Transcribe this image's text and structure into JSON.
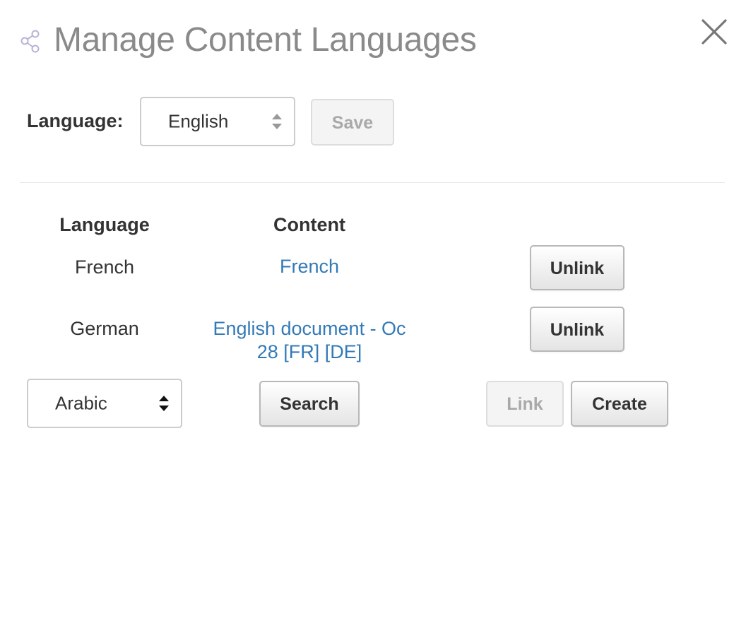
{
  "dialog": {
    "title": "Manage Content Languages",
    "icon": "share-icon"
  },
  "top_form": {
    "label": "Language:",
    "select_value": "English",
    "save_label": "Save"
  },
  "table": {
    "headers": {
      "language": "Language",
      "content": "Content"
    },
    "rows": [
      {
        "language": "French",
        "content_line1": "French",
        "content_line2": "",
        "action_label": "Unlink"
      },
      {
        "language": "German",
        "content_line1": "English document - Oc",
        "content_line2": "28 [FR] [DE]",
        "action_label": "Unlink"
      }
    ],
    "new_row": {
      "select_value": "Arabic",
      "search_label": "Search",
      "link_label": "Link",
      "create_label": "Create"
    }
  },
  "colors": {
    "title": "#8a8a8a",
    "link": "#337ab7",
    "icon": "#b9b3d8"
  }
}
